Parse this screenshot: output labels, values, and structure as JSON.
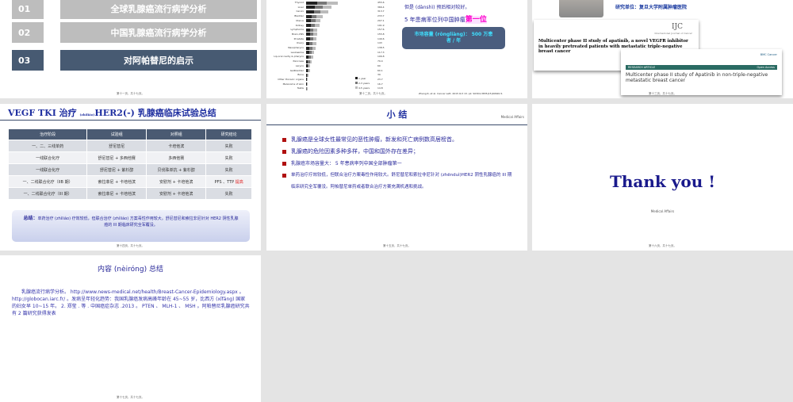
{
  "slides": [
    {
      "footer": "第十一页，共十七页。",
      "agenda": [
        {
          "num": "01",
          "label": "全球乳腺癌流行病学分析"
        },
        {
          "num": "02",
          "label": "中国乳腺癌流行病学分析"
        },
        {
          "num": "03",
          "label": "对阿帕替尼的启示"
        }
      ]
    },
    {
      "footer": "第十二页，共十七页。",
      "text1": "但是 (dànshì) 预后相对较好。",
      "text2_prefix": "5 年患病率位列中国肿瘤",
      "text2_highlight": "第一位",
      "box": "市场容量 (rōngliàng)： 500 万患者 / 年",
      "citation": "Zheng R, et al. Cancer Lett. 2015 Oct 13. pii: S0304-3835(15)00620-5."
    },
    {
      "footer": "第十三页，共十七页。",
      "unit": "研究单位：复旦大学附属肿瘤医院",
      "paper1": {
        "journal": "IJC",
        "journal_sub": "International Journal of Cancer",
        "title": "Multicenter phase II study of apatinib, a novel VEGFR inhibitor in heavily pretreated patients with metastatic triple-negative breast cancer"
      },
      "paper2": {
        "journal": "BMC Cancer",
        "section": "RESEARCH ARTICLE",
        "access": "Open Access",
        "title": "Multicenter phase II study of Apatinib in non-triple-negative metastatic breast cancer"
      }
    },
    {
      "footer": "第十四页，共十七页。",
      "title_a": "VEGF TKI 治疗 ",
      "title_pinyin": "(zhìliáo)",
      "title_b": "HER2(-) 乳腺癌临床试验总结",
      "headers": [
        "治疗阶段",
        "试验组",
        "对照组",
        "研究结论"
      ],
      "rows": [
        [
          "一、二、三线单药",
          "舒尼替尼",
          "卡培他滨",
          "失败"
        ],
        [
          "一线联合化疗",
          "舒尼替尼 + 多西他赛",
          "多西他赛",
          "失败"
        ],
        [
          "一线联合化疗",
          "舒尼替尼 + 紫杉醇",
          "贝伐珠单抗 + 紫杉醇",
          "失败"
        ],
        [
          "一、二线联合化疗（IIB 期）",
          "索拉菲尼 + 卡培他滨",
          "安慰剂 + 卡培他滨",
          "PFS 、TTP 提高"
        ],
        [
          "一、二线联合化疗（III 期）",
          "索拉菲尼 + 卡培他滨",
          "安慰剂 + 卡培他滨",
          "失败"
        ]
      ],
      "summary_label": "总结：",
      "summary": "单药治疗 (zhìliáo) 疗效较低，但联合治疗 (zhìliáo) 方案毒性作用较大。舒尼替尼和索拉非尼针对 HER2 阴性乳腺癌的 III 期临床研究全军覆没。"
    },
    {
      "footer": "第十五页，共十七页。",
      "title": "小 结",
      "logo": "Medical Affairs",
      "bullets": [
        "乳腺癌是全球女性最常见的恶性肿瘤，新发和死亡病例数高居榜首。",
        "乳腺癌的危险因素多种多样，中国和国外存在差异；",
        "乳腺癌市场容量大： 5 年患病率列中国全部肿瘤第一",
        "单药治疗疗效较低，但联合治疗方案毒性作用较大。舒尼替尼和索拉非尼针对 (zhēnduì)HER2 阴性乳腺癌的 III 期临床研究全军覆没。阿帕替尼单药或者联合治疗方案充满机遇和挑战。"
      ]
    },
    {
      "footer": "第十六页，共十七页。",
      "thanks": "Thank you !",
      "logo": "Medical Affairs"
    },
    {
      "footer": "第十七页，共十七页。",
      "title": "内容 (nèiróng) 总结",
      "body": "乳腺癌流行病学分析。 http://www.news-medical.net/health/Breast-Cancer-Epidemiology.aspx 。 http://globocan.iarc.fr/ 。发病呈年轻化趋势：我国乳腺癌发病高峰年龄在 45~55 岁，比西方 (xīfāng) 国家的妇女早 10~15 年。 2. 郑莹 . 等 . 中国癌症杂志 .2013 。 PTEN 、 MLH-1 、 MSH 。阿帕替尼乳腺癌研究共有 2 篇研究获得发表"
    }
  ],
  "chart_data": {
    "type": "bar",
    "orientation": "horizontal",
    "stacked": true,
    "categories": [
      "Thyroid",
      "Liver",
      "Cervix",
      "Bladder",
      "Uterus",
      "Kidney",
      "Lymphoma",
      "Brain,CNS",
      "Prostate",
      "Ovary",
      "Nasopharynx",
      "Leukaemia",
      "Lip,oral cavity & pharynx",
      "Pancreas",
      "Larynx",
      "Gallbladder",
      "Bone",
      "Other thoracic organs",
      "Melanoma of skin",
      "Testis"
    ],
    "totals": [
      455.6,
      366.4,
      313.7,
      233.7,
      207.1,
      191.9,
      157.6,
      155.8,
      149.6,
      143.0,
      138.5,
      117.3,
      106.8,
      79.4,
      60.0,
      60.1,
      39.0,
      23.7,
      16.7,
      14.8
    ],
    "legend": [
      "1 year",
      "2-3 years",
      "4-5 years"
    ],
    "colors": [
      "#222222",
      "#777777",
      "#bbbbbb"
    ]
  }
}
